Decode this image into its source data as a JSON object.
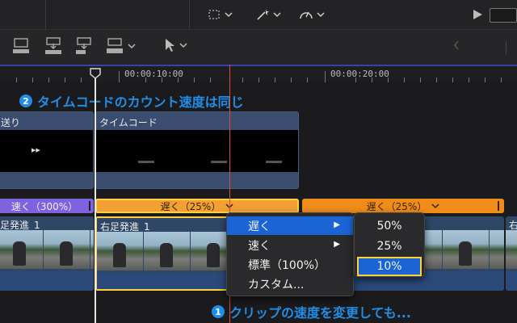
{
  "timeline": {
    "timecodes": [
      "00:00:10:00",
      "00:00:20:00"
    ]
  },
  "annotations": {
    "speed_same": {
      "number": "2",
      "text": "タイムコードのカウント速度は同じ"
    },
    "clip_speed": {
      "number": "1",
      "text": "クリップの速度を変更しても..."
    }
  },
  "connected_clips": [
    {
      "label": "送り"
    },
    {
      "label": "タイムコード"
    }
  ],
  "speed_bars": [
    {
      "label": "速く（300%）"
    },
    {
      "label": "遅く（25%）"
    },
    {
      "label": "遅く（25%）"
    }
  ],
  "clips": [
    {
      "name": "足発進_1"
    },
    {
      "name": "右足発進_1"
    },
    {
      "name": "右"
    }
  ],
  "context_menu": {
    "items": [
      {
        "label": "遅く",
        "has_submenu": true
      },
      {
        "label": "速く",
        "has_submenu": true
      },
      {
        "label": "標準（100%）",
        "has_submenu": false
      },
      {
        "label": "カスタム...",
        "has_submenu": false
      }
    ],
    "submenu": [
      "50%",
      "25%",
      "10%"
    ]
  },
  "colors": {
    "accent_blue": "#1f8ee8",
    "speed_slow": "#f08c1a",
    "speed_fast": "#7e63e0",
    "highlight": "#ffd23c"
  }
}
